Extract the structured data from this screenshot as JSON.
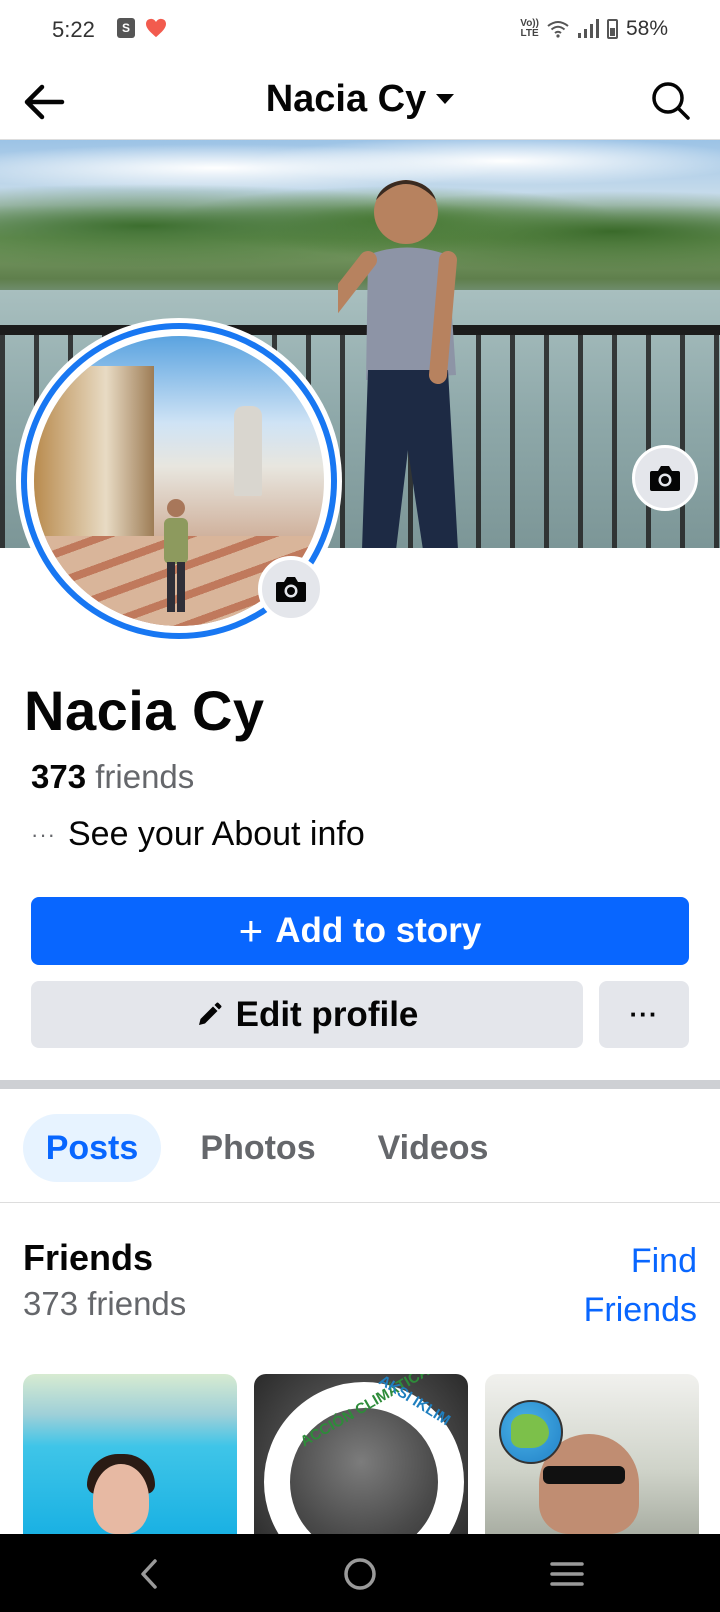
{
  "status_bar": {
    "time": "5:22",
    "battery": "58%",
    "volte_top": "Vo))",
    "volte_bottom": "LTE",
    "shop_glyph": "S"
  },
  "header": {
    "title": "Nacia Cy",
    "back_icon": "arrow-left-icon",
    "search_icon": "search-icon"
  },
  "profile": {
    "name": "Nacia Cy",
    "friends_number": "373",
    "friends_word": "friends",
    "about_dots": "···",
    "about_text": "See your About info"
  },
  "actions": {
    "add_story_plus": "+",
    "add_story_label": "Add to story",
    "edit_profile_label": "Edit profile",
    "more_label": "···"
  },
  "tabs": [
    {
      "label": "Posts",
      "active": true
    },
    {
      "label": "Photos",
      "active": false
    },
    {
      "label": "Videos",
      "active": false
    }
  ],
  "friends_section": {
    "title": "Friends",
    "count": "373 friends",
    "find_friends": "Find Friends"
  },
  "friend_thumb_2": {
    "ring_text_left": "ACCIÓN CLIMÁTICA",
    "ring_text_right": "AKSI IKLIM"
  },
  "colors": {
    "primary_blue": "#0866ff",
    "button_grey": "#e4e6eb",
    "muted_text": "#65676b",
    "avatar_ring": "#1877f2"
  }
}
